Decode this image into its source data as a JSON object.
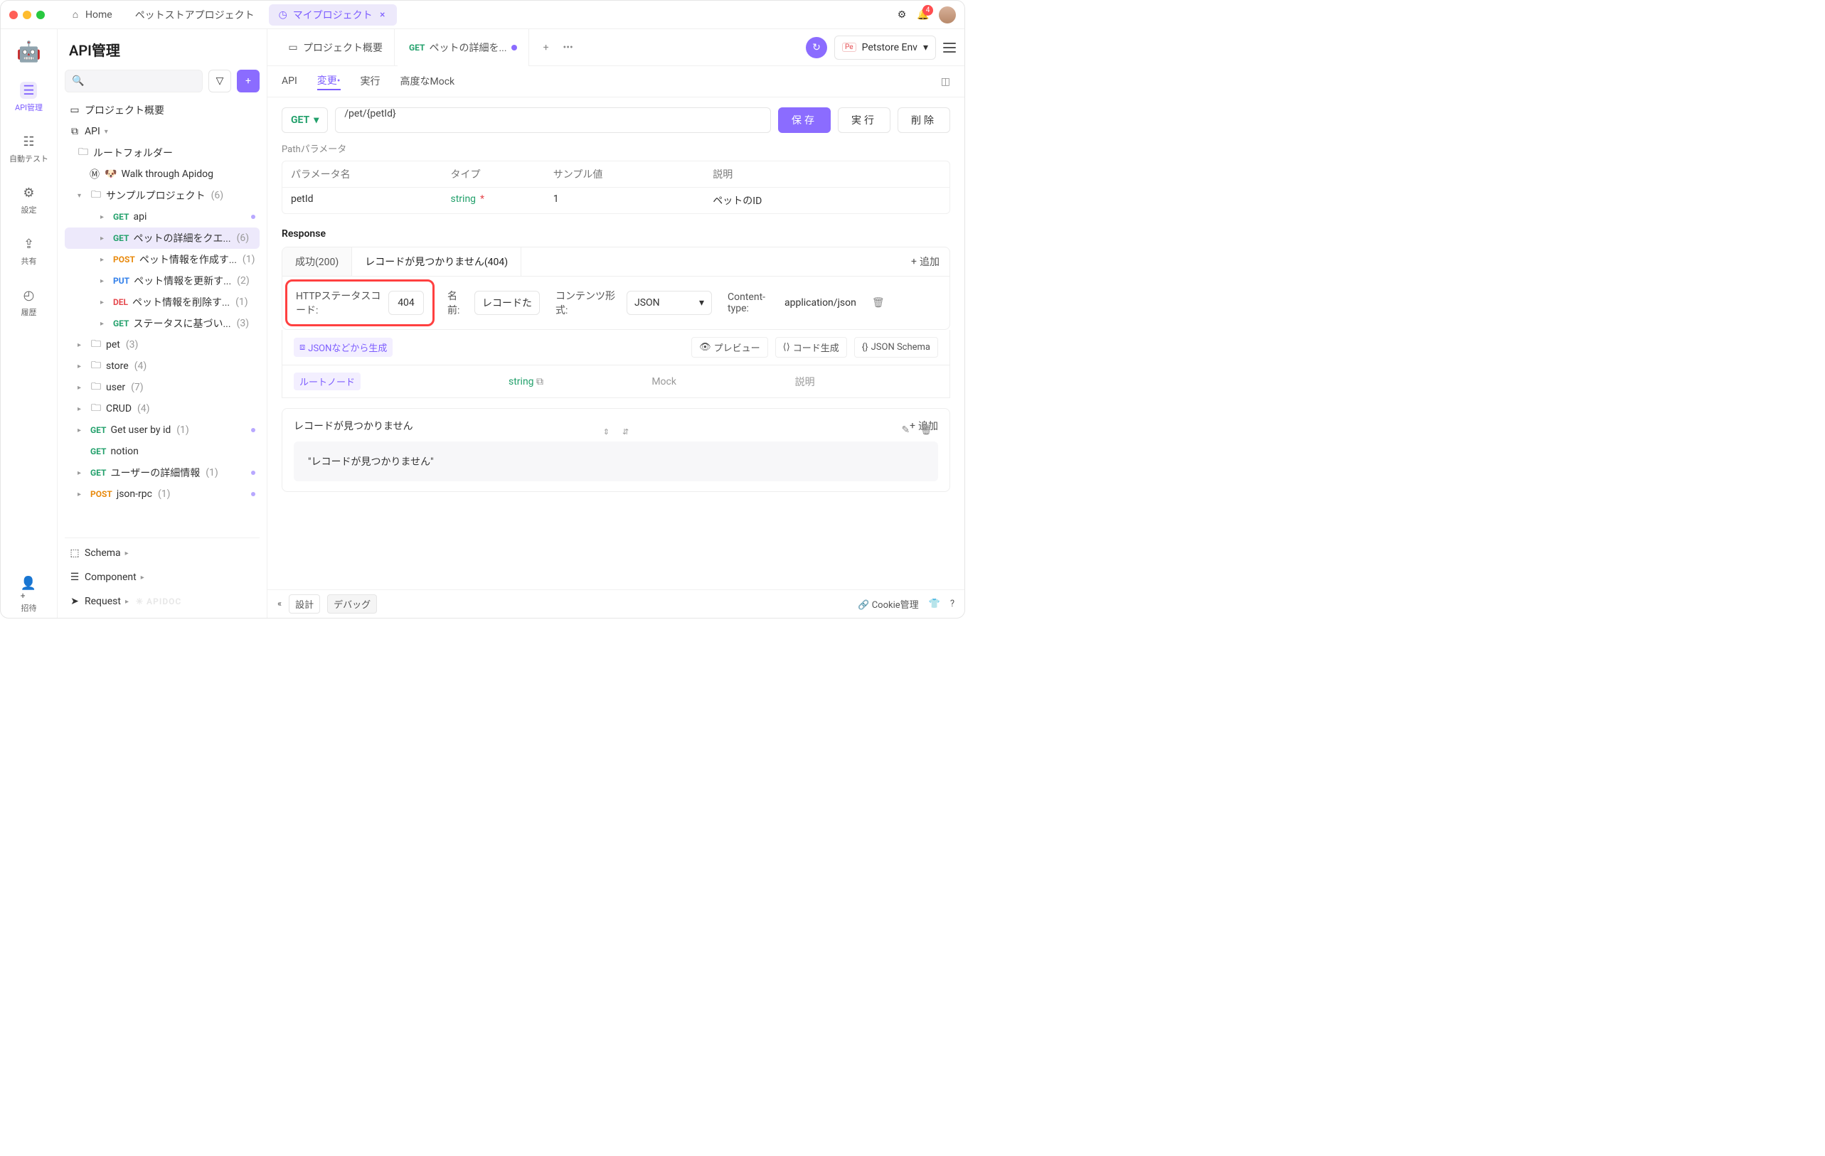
{
  "titlebar": {
    "home": "Home",
    "tab1": "ペットストアプロジェクト",
    "tab2": "マイプロジェクト",
    "notif_count": "4"
  },
  "rail": {
    "api": "API管理",
    "autotest": "自動テスト",
    "settings": "設定",
    "share": "共有",
    "history": "履歴",
    "invite": "招待"
  },
  "sidebar": {
    "title": "API管理",
    "overview": "プロジェクト概要",
    "api_label": "API",
    "root": "ルートフォルダー",
    "walk": "Walk through Apidog",
    "sample": "サンプルプロジェクト",
    "sample_cnt": "(6)",
    "items": [
      {
        "m": "GET",
        "mcls": "m-get",
        "t": "api",
        "cnt": "",
        "dot": true
      },
      {
        "m": "GET",
        "mcls": "m-get",
        "t": "ペットの詳細をクエ...",
        "cnt": "(6)",
        "sel": true
      },
      {
        "m": "POST",
        "mcls": "m-post",
        "t": "ペット情報を作成す...",
        "cnt": "(1)"
      },
      {
        "m": "PUT",
        "mcls": "m-put",
        "t": "ペット情報を更新す...",
        "cnt": "(2)"
      },
      {
        "m": "DEL",
        "mcls": "m-del",
        "t": "ペット情報を削除す...",
        "cnt": "(1)"
      },
      {
        "m": "GET",
        "mcls": "m-get",
        "t": "ステータスに基づい...",
        "cnt": "(3)"
      }
    ],
    "folders": [
      {
        "t": "pet",
        "cnt": "(3)"
      },
      {
        "t": "store",
        "cnt": "(4)"
      },
      {
        "t": "user",
        "cnt": "(7)"
      },
      {
        "t": "CRUD",
        "cnt": "(4)"
      }
    ],
    "extra": [
      {
        "m": "GET",
        "mcls": "m-get",
        "t": "Get user by id",
        "cnt": "(1)",
        "dot": true,
        "chev": true
      },
      {
        "m": "GET",
        "mcls": "m-get",
        "t": "notion",
        "cnt": "",
        "chev": false
      },
      {
        "m": "GET",
        "mcls": "m-get",
        "t": "ユーザーの詳細情報",
        "cnt": "(1)",
        "dot": true,
        "chev": true
      },
      {
        "m": "POST",
        "mcls": "m-post",
        "t": "json-rpc",
        "cnt": "(1)",
        "dot": true,
        "chev": true
      }
    ],
    "schema": "Schema",
    "component": "Component",
    "request": "Request",
    "watermark": "✳ APIDOC"
  },
  "tabs": {
    "overview": "プロジェクト概要",
    "active_method": "GET",
    "active_title": "ペットの詳細を...",
    "env_badge": "Pe",
    "env": "Petstore Env"
  },
  "subtabs": {
    "api": "API",
    "change": "変更",
    "run": "実行",
    "mock": "高度なMock"
  },
  "url": {
    "method": "GET",
    "path": "/pet/{petId}",
    "save": "保存",
    "run": "実行",
    "delete": "削除"
  },
  "params": {
    "section": "Pathパラメータ",
    "h_name": "パラメータ名",
    "h_type": "タイプ",
    "h_sample": "サンプル値",
    "h_desc": "説明",
    "name": "petId",
    "type": "string",
    "sample": "1",
    "desc": "ペットのID"
  },
  "response": {
    "title": "Response",
    "t1": "成功(200)",
    "t2": "レコードが見つかりません(404)",
    "add": "追加",
    "status_label": "HTTPステータスコード:",
    "status_val": "404",
    "name_label": "名前:",
    "name_val": "レコードた",
    "fmt_label": "コンテンツ形式:",
    "fmt_val": "JSON",
    "ct_label": "Content-type:",
    "ct_val": "application/json",
    "gen": "JSONなどから生成",
    "preview": "プレビュー",
    "codegen": "コード生成",
    "schema": "JSON Schema",
    "root": "ルートノード",
    "string": "string",
    "mock": "Mock",
    "desc": "説明",
    "ex_title": "レコードが見つかりません",
    "ex_add": "追加",
    "ex_body": "\"レコードが見つかりません\""
  },
  "footer": {
    "design": "設計",
    "debug": "デバッグ",
    "cookie": "Cookie管理"
  }
}
